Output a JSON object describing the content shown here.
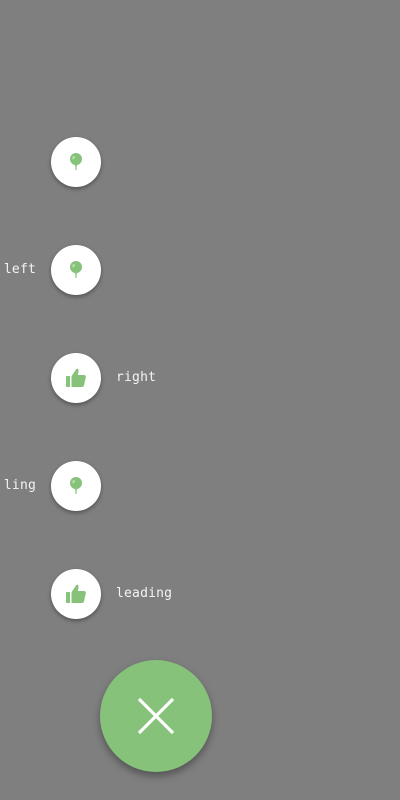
{
  "colors": {
    "background": "#7f7f7f",
    "accent": "#86c27a",
    "label_text": "#f4f4f4",
    "mini_fab_bg": "#ffffff"
  },
  "speed_dial": {
    "items": [
      {
        "icon": "balloon-icon",
        "label": ""
      },
      {
        "icon": "balloon-icon",
        "label": "left"
      },
      {
        "icon": "thumb-up-icon",
        "label": "right"
      },
      {
        "icon": "balloon-icon",
        "label": "ling"
      },
      {
        "icon": "thumb-up-icon",
        "label": "leading"
      }
    ],
    "main_button_icon": "close-icon"
  }
}
